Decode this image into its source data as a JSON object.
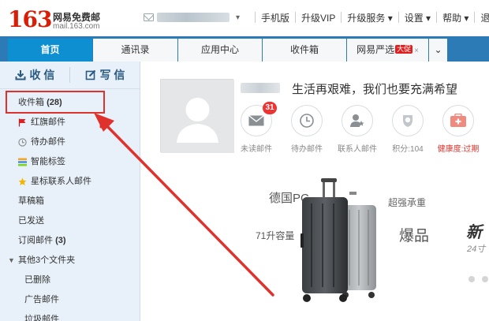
{
  "header": {
    "logo_number": "163",
    "logo_name": "网易免费邮",
    "logo_url": "mail.163.com",
    "caret": "▾",
    "nav": [
      {
        "label": "手机版"
      },
      {
        "label": "升级VIP"
      },
      {
        "label": "升级服务 ▾"
      },
      {
        "label": "设置 ▾"
      },
      {
        "label": "帮助 ▾"
      },
      {
        "label": "退"
      }
    ]
  },
  "tabs": [
    {
      "label": "首页",
      "active": true
    },
    {
      "label": "通讯录"
    },
    {
      "label": "应用中心"
    },
    {
      "label": "收件箱"
    },
    {
      "label": "网易严选",
      "badge": "大促",
      "close": "×"
    },
    {
      "label": "⌄"
    }
  ],
  "sidebar": {
    "receive_label": "收 信",
    "write_label": "写 信",
    "folders": [
      {
        "label": "收件箱",
        "count": "(28)"
      },
      {
        "label": "红旗邮件",
        "icon": "red-flag-icon"
      },
      {
        "label": "待办邮件",
        "icon": "clock-icon"
      },
      {
        "label": "智能标签",
        "icon": "tag-stack-icon"
      },
      {
        "label": "星标联系人邮件",
        "icon": "star-icon"
      },
      {
        "label": "草稿箱"
      },
      {
        "label": "已发送"
      },
      {
        "label": "订阅邮件",
        "count": "(3)"
      }
    ],
    "group_caret": "▼",
    "group_label": "其他3个文件夹",
    "sub_folders": [
      {
        "label": "已删除"
      },
      {
        "label": "广告邮件"
      },
      {
        "label": "垃圾邮件"
      }
    ]
  },
  "main": {
    "greeting": "生活再艰难，我们也要充满希望",
    "stats": [
      {
        "label": "未读邮件",
        "icon": "envelope-icon",
        "badge": "31"
      },
      {
        "label": "待办邮件",
        "icon": "clock-icon"
      },
      {
        "label": "联系人邮件",
        "icon": "contact-star-icon"
      },
      {
        "label": "积分:104",
        "icon": "points-icon"
      },
      {
        "label": "健康度:过期",
        "icon": "health-kit-icon",
        "alert": true
      }
    ],
    "ad": {
      "line1": "德国PC",
      "line2": "超强承重",
      "line3": "71升容量",
      "line4": "爆品",
      "line5": "新",
      "line6": "24寸"
    }
  },
  "colors": {
    "brand_red": "#d81e06",
    "tabbar_blue": "#2d7bb6",
    "active_tab": "#0e8fd1",
    "sidebar_bg": "#e8f1f9",
    "highlight_red": "#e0322c"
  }
}
